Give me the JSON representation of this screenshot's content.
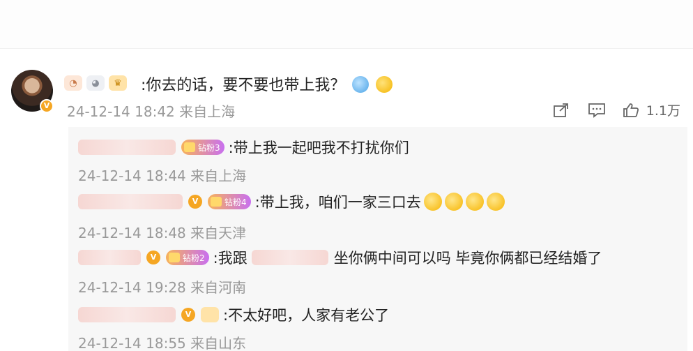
{
  "main_comment": {
    "text": ":你去的话，要不要也带上我？",
    "meta": "24-12-14 18:42 来自上海",
    "verified_mark": "V",
    "actions": {
      "like_count": "1.1万"
    }
  },
  "replies": [
    {
      "fan_badge": "钻粉3",
      "text": ":带上我一起吧我不打扰你们",
      "meta": "24-12-14 18:44 来自上海"
    },
    {
      "verified_mark": "V",
      "fan_badge": "钻粉4",
      "text": ":带上我，咱们一家三口去",
      "meta": "24-12-14 18:48 来自天津"
    },
    {
      "verified_mark": "V",
      "fan_badge": "钻粉2",
      "text_before": ":我跟",
      "text_after": "坐你俩中间可以吗 毕竟你俩都已经结婚了",
      "meta": "24-12-14 19:28 来自河南"
    },
    {
      "verified_mark": "V",
      "text": ":不太好吧，人家有老公了",
      "meta": "24-12-14 18:55 来自山东"
    }
  ]
}
